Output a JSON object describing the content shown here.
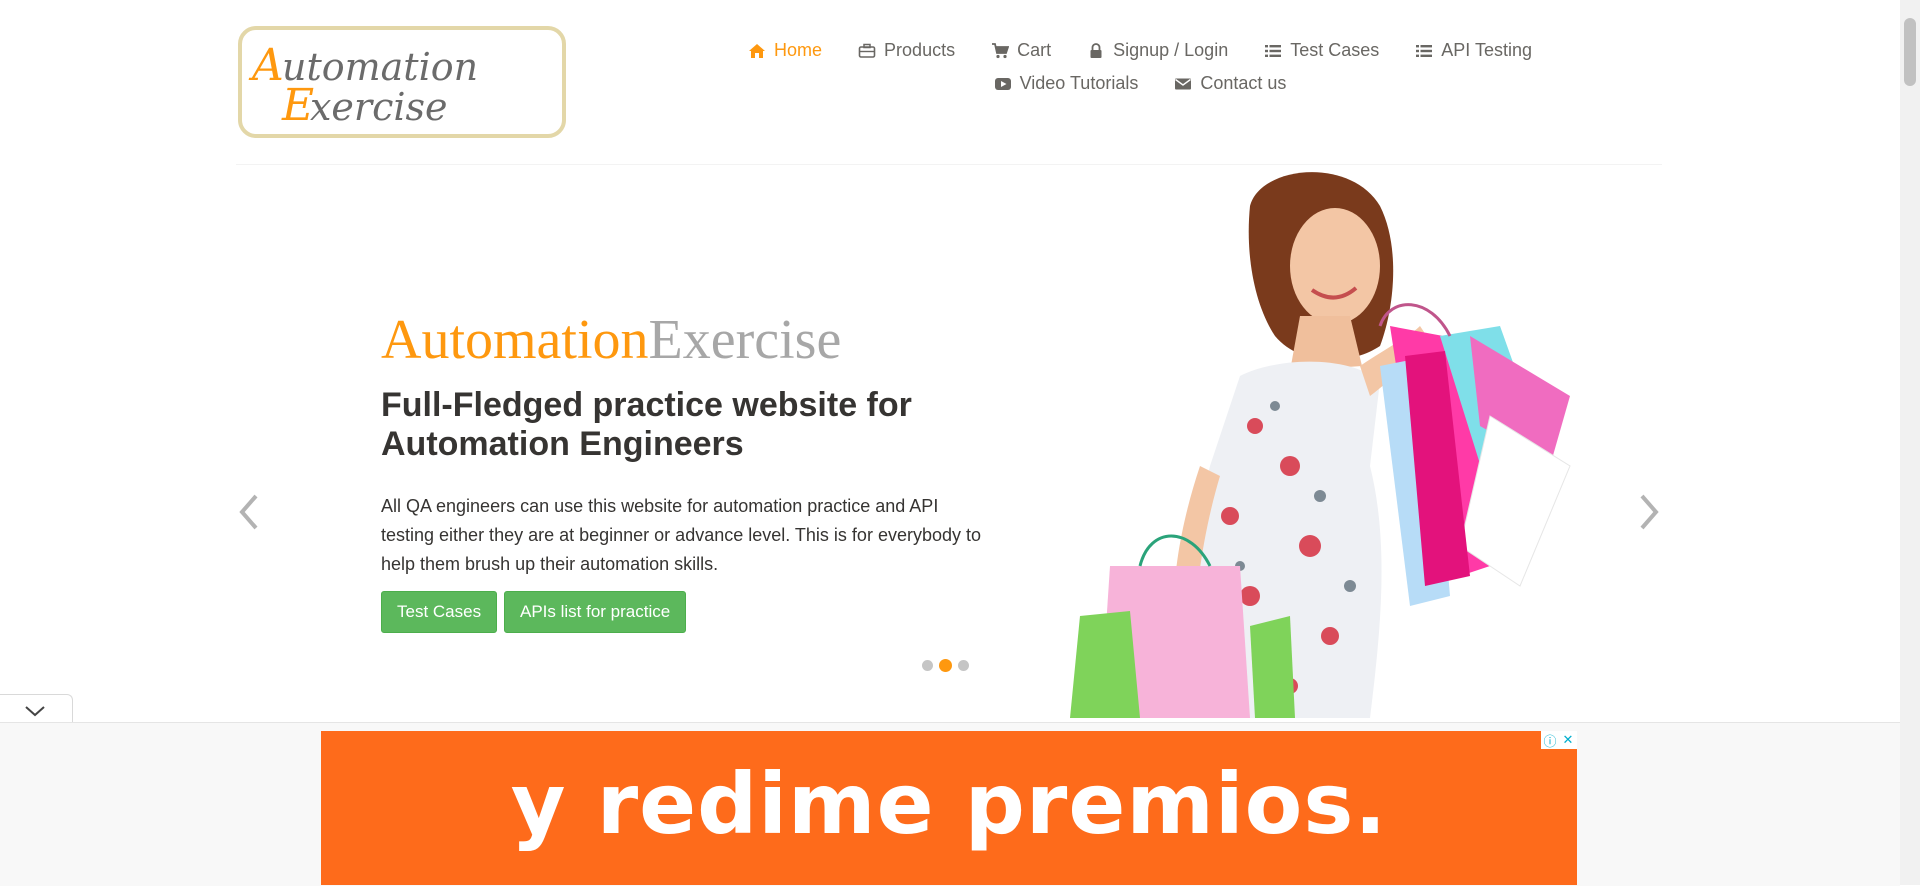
{
  "header": {
    "logo_text": "Automation Exercise",
    "nav": [
      {
        "label": "Home",
        "icon": "home-icon",
        "active": true
      },
      {
        "label": "Products",
        "icon": "briefcase-icon"
      },
      {
        "label": "Cart",
        "icon": "cart-icon"
      },
      {
        "label": "Signup / Login",
        "icon": "lock-icon"
      },
      {
        "label": "Test Cases",
        "icon": "list-icon"
      },
      {
        "label": "API Testing",
        "icon": "list-icon"
      },
      {
        "label": "Video Tutorials",
        "icon": "youtube-play-icon"
      },
      {
        "label": "Contact us",
        "icon": "envelope-icon"
      }
    ]
  },
  "slider": {
    "brand_part1": "Automation",
    "brand_part2": "Exercise",
    "headline": "Full-Fledged practice website for Automation Engineers",
    "description": "All QA engineers can use this website for automation practice and API testing either they are at beginner or advance level. This is for everybody to help them brush up their automation skills.",
    "buttons": {
      "test_cases": "Test Cases",
      "apis_list": "APIs list for practice"
    },
    "dots_count": 3,
    "active_dot": 2
  },
  "ad": {
    "text": "y redime premios.",
    "info_glyph": "ⓘ",
    "close_glyph": "✕"
  },
  "colors": {
    "accent": "#fe980f",
    "button_green": "#5cb85c",
    "ad_orange": "#fe6b1b",
    "text_dark": "#363432",
    "text_nav": "#696763"
  }
}
